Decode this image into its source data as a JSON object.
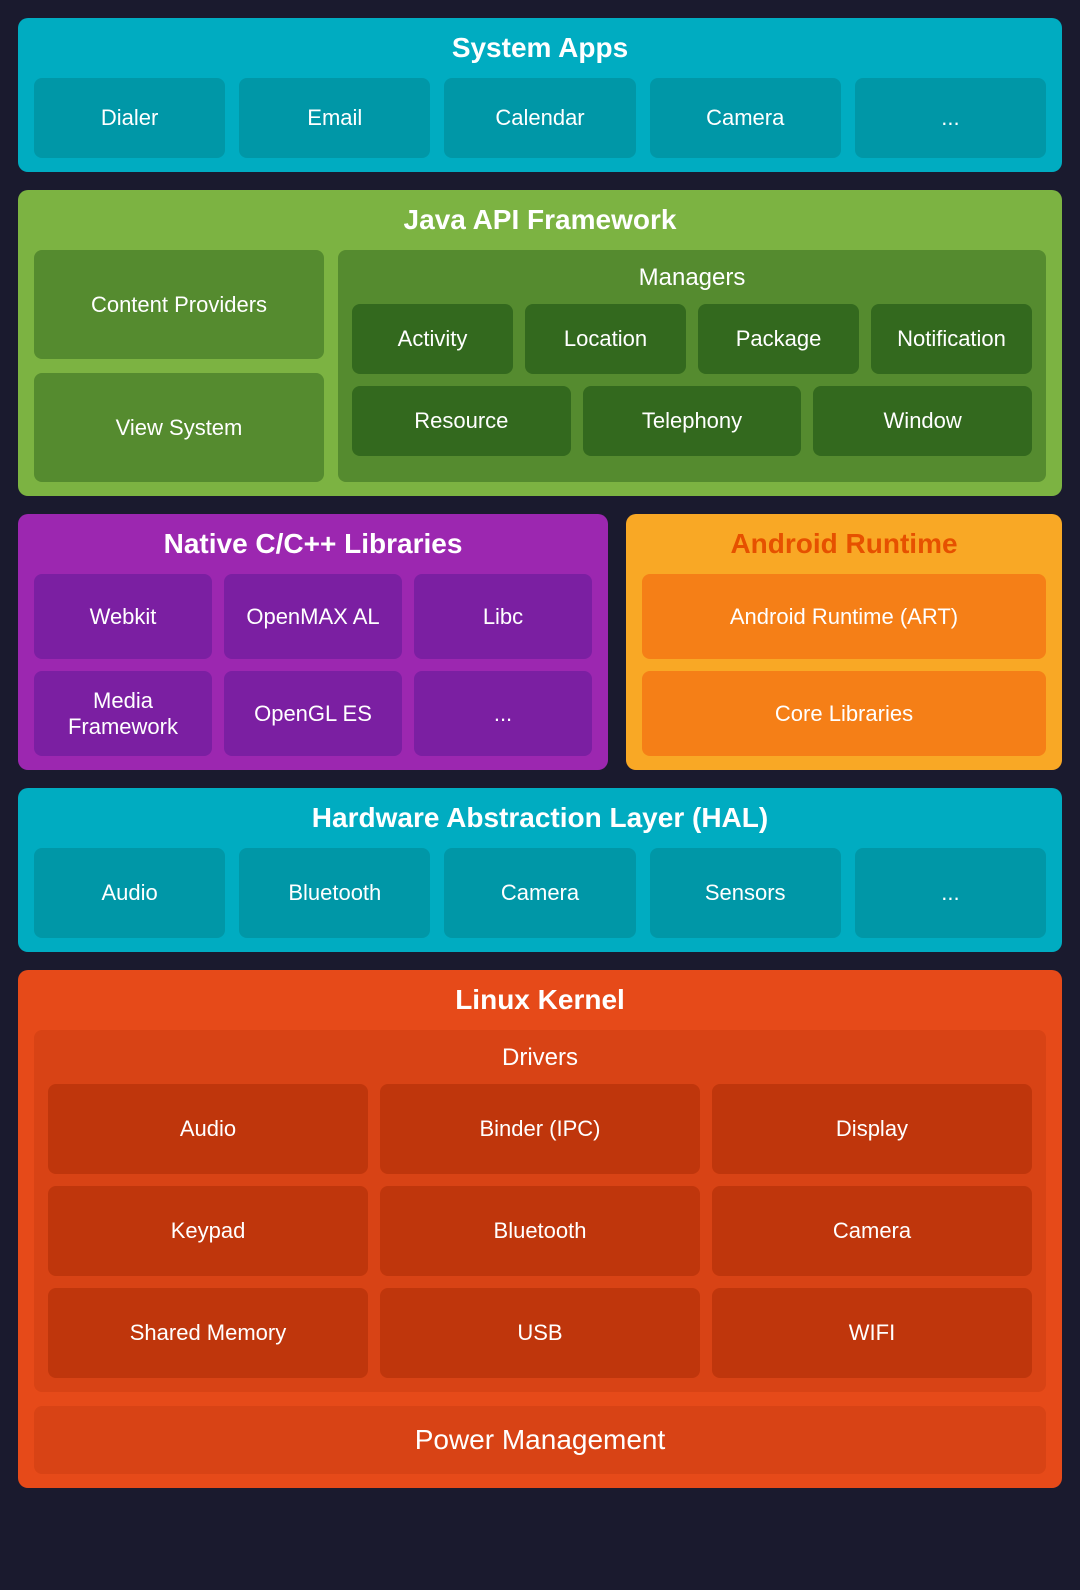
{
  "systemApps": {
    "title": "System Apps",
    "apps": [
      "Dialer",
      "Email",
      "Calendar",
      "Camera",
      "..."
    ]
  },
  "javaApi": {
    "title": "Java API Framework",
    "left": [
      "Content Providers",
      "View System"
    ],
    "managers": {
      "title": "Managers",
      "row1": [
        "Activity",
        "Location",
        "Package",
        "Notification"
      ],
      "row2": [
        "Resource",
        "Telephony",
        "Window"
      ]
    }
  },
  "native": {
    "title": "Native C/C++ Libraries",
    "row1": [
      "Webkit",
      "OpenMAX AL",
      "Libc"
    ],
    "row2": [
      "Media Framework",
      "OpenGL ES",
      "..."
    ]
  },
  "androidRuntime": {
    "title": "Android Runtime",
    "items": [
      "Android Runtime (ART)",
      "Core Libraries"
    ]
  },
  "hal": {
    "title": "Hardware Abstraction Layer (HAL)",
    "items": [
      "Audio",
      "Bluetooth",
      "Camera",
      "Sensors",
      "..."
    ]
  },
  "linux": {
    "title": "Linux Kernel",
    "drivers": {
      "title": "Drivers",
      "row1": [
        "Audio",
        "Binder (IPC)",
        "Display"
      ],
      "row2": [
        "Keypad",
        "Bluetooth",
        "Camera"
      ],
      "row3": [
        "Shared Memory",
        "USB",
        "WIFI"
      ]
    },
    "powerManagement": "Power Management"
  }
}
